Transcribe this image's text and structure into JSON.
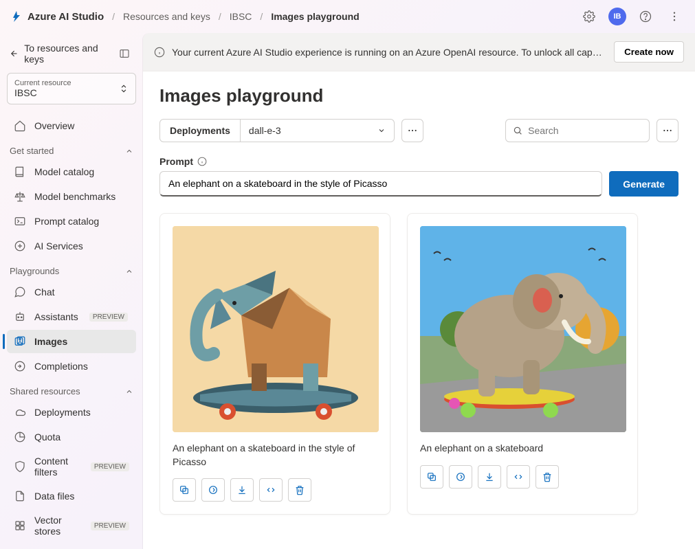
{
  "topbar": {
    "brand": "Azure AI Studio",
    "breadcrumb": [
      "Resources and keys",
      "IBSC",
      "Images playground"
    ],
    "avatar_initials": "IB"
  },
  "sidebar": {
    "back_label": "To resources and keys",
    "resource_label": "Current resource",
    "resource_value": "IBSC",
    "overview": "Overview",
    "sections": {
      "getstarted": {
        "title": "Get started",
        "items": [
          "Model catalog",
          "Model benchmarks",
          "Prompt catalog",
          "AI Services"
        ]
      },
      "playgrounds": {
        "title": "Playgrounds",
        "items": [
          "Chat",
          "Assistants",
          "Images",
          "Completions"
        ],
        "preview_idx": [
          1
        ]
      },
      "shared": {
        "title": "Shared resources",
        "items": [
          "Deployments",
          "Quota",
          "Content filters",
          "Data files",
          "Vector stores"
        ],
        "preview_idx": [
          2,
          4
        ]
      }
    },
    "preview_badge": "PREVIEW"
  },
  "banner": {
    "text": "Your current Azure AI Studio experience is running on an Azure OpenAI resource. To unlock all capabilities, create a…",
    "button": "Create now"
  },
  "page": {
    "title": "Images playground",
    "dep_label": "Deployments",
    "dep_value": "dall-e-3",
    "search_placeholder": "Search",
    "prompt_label": "Prompt",
    "prompt_value": "An elephant on a skateboard in the style of Picasso",
    "generate": "Generate"
  },
  "results": [
    {
      "caption": "An elephant on a skateboard in the style of Picasso"
    },
    {
      "caption": "An elephant on a skateboard"
    }
  ],
  "icons": {
    "settings": "gear-icon",
    "help": "help-icon",
    "more": "ellipsis-icon",
    "copy": "copy-icon",
    "regen": "regenerate-icon",
    "download": "download-icon",
    "code": "code-icon",
    "delete": "delete-icon"
  }
}
